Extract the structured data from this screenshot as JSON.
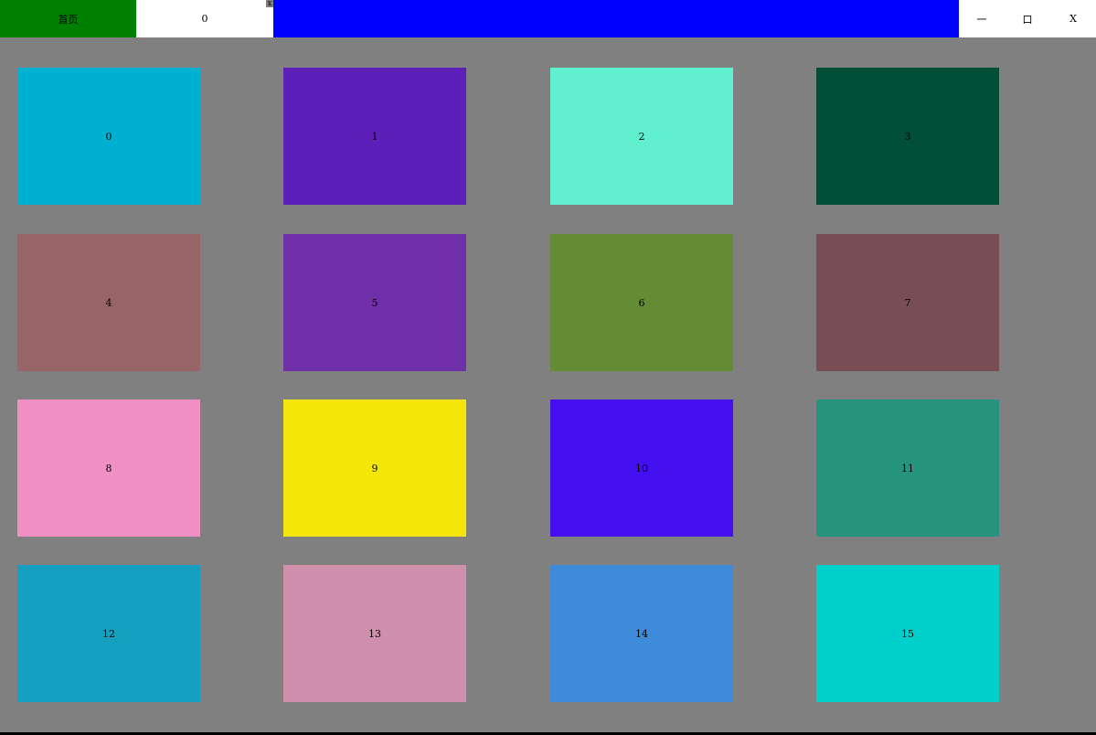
{
  "titlebar": {
    "home_tab_label": "首页",
    "home_tab_color": "#008000",
    "counter_tab_label": "0",
    "tab_close_label": "x",
    "drag_area_color": "#0000ff",
    "minimize_label": "一",
    "maximize_label": "口",
    "close_label": "X"
  },
  "grid": {
    "background": "#808080",
    "tiles": [
      {
        "label": "0",
        "color": "#00b0d0"
      },
      {
        "label": "1",
        "color": "#5c20b8"
      },
      {
        "label": "2",
        "color": "#60f0d0"
      },
      {
        "label": "3",
        "color": "#005038"
      },
      {
        "label": "4",
        "color": "#986468"
      },
      {
        "label": "5",
        "color": "#7030aa"
      },
      {
        "label": "6",
        "color": "#648c34"
      },
      {
        "label": "7",
        "color": "#784e54"
      },
      {
        "label": "8",
        "color": "#f090c4"
      },
      {
        "label": "9",
        "color": "#f4e608"
      },
      {
        "label": "10",
        "color": "#4410f0"
      },
      {
        "label": "11",
        "color": "#26947c"
      },
      {
        "label": "12",
        "color": "#14a0c0"
      },
      {
        "label": "13",
        "color": "#d090ac"
      },
      {
        "label": "14",
        "color": "#408ada"
      },
      {
        "label": "15",
        "color": "#00d0cc"
      }
    ]
  }
}
